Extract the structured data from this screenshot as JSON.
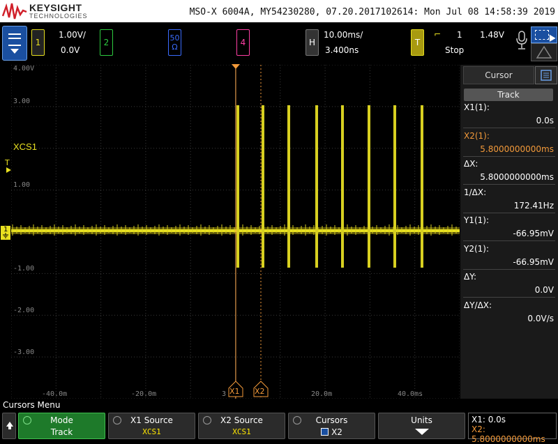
{
  "header": {
    "brand": "KEYSIGHT",
    "brand_sub": "TECHNOLOGIES",
    "info": "MSO-X 6004A, MY54230280, 07.20.2017102614: Mon Jul 08 14:58:39 2019"
  },
  "controls": {
    "ch1_num": "1",
    "ch1_scale": "1.00V/",
    "ch1_offset": "0.0V",
    "ch2_num": "2",
    "ch3_num": "50",
    "ch3_imp": "Ω",
    "ch4_num": "4",
    "h_label": "H",
    "time_scale": "10.00ms/",
    "time_delay": "3.400ns",
    "trig_label": "T",
    "trig_symbol": "⌐",
    "trig_source": "1",
    "trig_level": "1.48V",
    "run_state": "Stop",
    "colors": {
      "ch1": "#e8e020",
      "ch2": "#2ecc40",
      "ch3": "#3b6cff",
      "ch4": "#ff3fa4",
      "cursor": "#f39a3a"
    }
  },
  "plot": {
    "y_ticks": [
      "4.00V",
      "3.00",
      "1.00",
      "-1.00",
      "-2.00",
      "-3.00"
    ],
    "x_ticks": [
      "-40.0m",
      "-20.0m",
      "3",
      "20.0m",
      "40.0ms"
    ],
    "channel_label": "XCS1",
    "trigger_marker": "T",
    "ground_marker": "1",
    "cursor_x1_label": "X1",
    "cursor_x2_label": "X2"
  },
  "sidebar": {
    "tab_label": "Cursor",
    "track_label": "Track",
    "rows": [
      {
        "label": "X1(1):",
        "value": "0.0s",
        "highlight": false
      },
      {
        "label": "X2(1):",
        "value": "5.8000000000ms",
        "highlight": true
      },
      {
        "label": "ΔX:",
        "value": "5.8000000000ms",
        "highlight": false
      },
      {
        "label": "1/ΔX:",
        "value": "172.41Hz",
        "highlight": false
      },
      {
        "label": "Y1(1):",
        "value": "-66.95mV",
        "highlight": false
      },
      {
        "label": "Y2(1):",
        "value": "-66.95mV",
        "highlight": false
      },
      {
        "label": "ΔY:",
        "value": "0.0V",
        "highlight": false
      },
      {
        "label": "ΔY/ΔX:",
        "value": "0.0V/s",
        "highlight": false
      }
    ]
  },
  "menu": {
    "title": "Cursors Menu",
    "mode_label": "Mode",
    "mode_value": "Track",
    "x1src_label": "X1 Source",
    "x1src_value": "XCS1",
    "x2src_label": "X2 Source",
    "x2src_value": "XCS1",
    "cursors_label": "Cursors",
    "cursors_value": "X2",
    "units_label": "Units",
    "readout_x1": "X1:  0.0s",
    "readout_x2": "X2:  5.8000000000ms"
  }
}
